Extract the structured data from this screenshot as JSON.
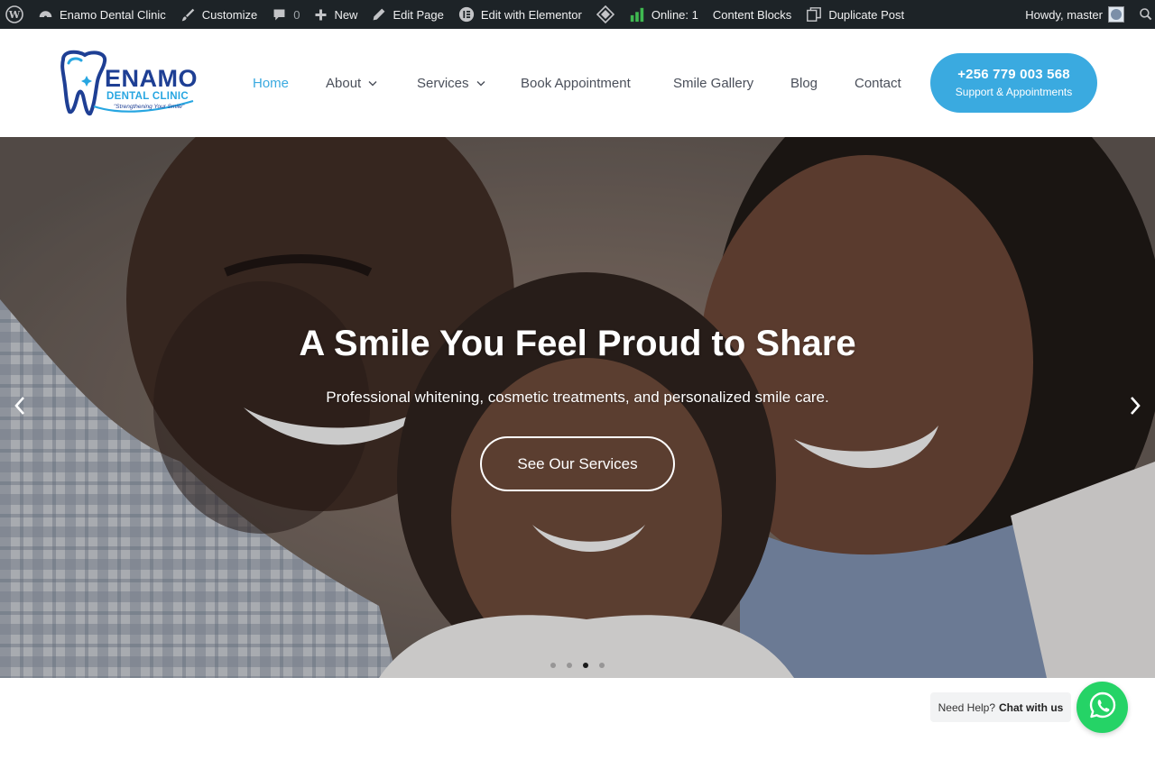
{
  "admin_bar": {
    "site_name": "Enamo Dental Clinic",
    "customize": "Customize",
    "comments_count": "0",
    "new": "New",
    "edit_page": "Edit Page",
    "edit_elementor": "Edit with Elementor",
    "online": "Online: 1",
    "content_blocks": "Content Blocks",
    "duplicate_post": "Duplicate Post",
    "howdy": "Howdy, master"
  },
  "logo": {
    "name": "ENAMO",
    "subtitle": "DENTAL CLINIC",
    "tagline": "\"Strengthening Your Smile\""
  },
  "nav": {
    "items": [
      {
        "label": "Home",
        "active": true
      },
      {
        "label": "About",
        "dropdown": true
      },
      {
        "label": "Services",
        "dropdown": true
      },
      {
        "label": "Book Appointment"
      },
      {
        "label": "Smile Gallery"
      },
      {
        "label": "Blog"
      },
      {
        "label": "Contact"
      }
    ]
  },
  "cta": {
    "phone": "+256 779 003 568",
    "subtitle": "Support & Appointments"
  },
  "hero": {
    "title": "A Smile You Feel Proud to Share",
    "subtitle": "Professional whitening, cosmetic treatments, and personalized smile care.",
    "button": "See Our Services",
    "slides_count": 4,
    "active_slide": 3
  },
  "whatsapp": {
    "prefix": "Need Help?",
    "label": "Chat with us"
  },
  "colors": {
    "accent": "#3aaae0",
    "logo_navy": "#1e3f94",
    "admin_bar": "#1d2327",
    "whatsapp": "#25d366"
  },
  "icons": [
    "wordpress-icon",
    "customize-brush-icon",
    "comment-icon",
    "plus-icon",
    "pencil-icon",
    "elementor-icon",
    "diamond-icon",
    "bar-chart-icon",
    "duplicate-icon",
    "avatar-icon",
    "search-icon",
    "chevron-down-icon",
    "chevron-left-icon",
    "chevron-right-icon",
    "whatsapp-icon",
    "tooth-logo-icon"
  ]
}
